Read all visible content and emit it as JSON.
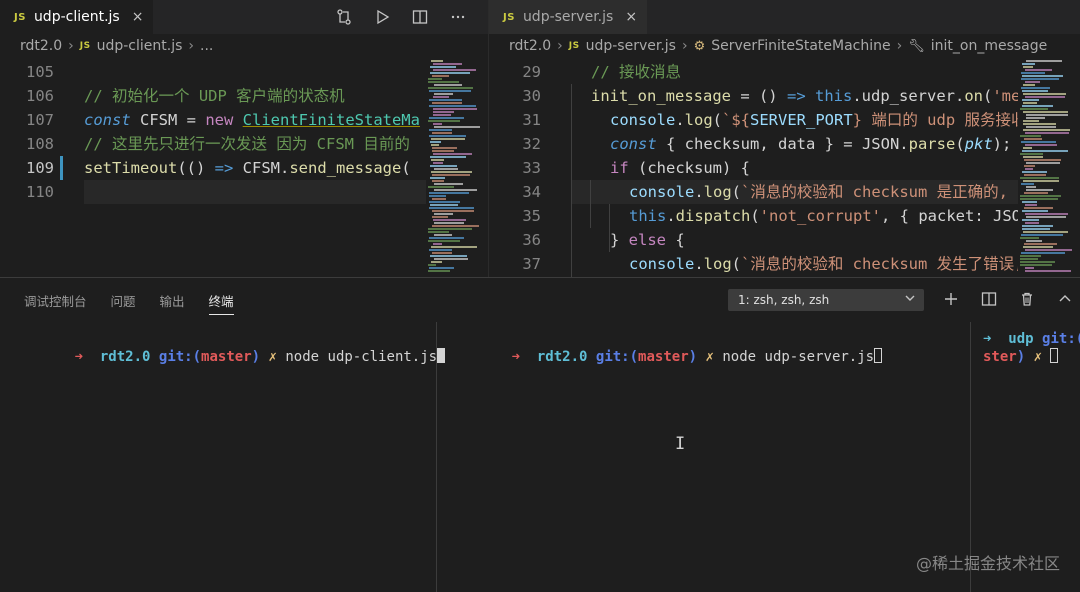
{
  "left_editor": {
    "tab": {
      "badge": "JS",
      "label": "udp-client.js",
      "close": "×"
    },
    "breadcrumb": {
      "folder": "rdt2.0",
      "badge": "JS",
      "file": "udp-client.js",
      "more": "..."
    },
    "lines": [
      {
        "n": "105",
        "segments": []
      },
      {
        "n": "106",
        "segments": [
          {
            "c": "c-comment",
            "t": "// 初始化一个 UDP 客户端的状态机"
          }
        ]
      },
      {
        "n": "107",
        "segments": [
          {
            "c": "c-kw",
            "t": "const"
          },
          {
            "c": "c-white",
            "t": " CFSM "
          },
          {
            "c": "c-white",
            "t": "= "
          },
          {
            "c": "c-new",
            "t": "new "
          },
          {
            "c": "c-cls",
            "t": "ClientFiniteStateMa"
          }
        ]
      },
      {
        "n": "108",
        "segments": [
          {
            "c": "c-comment",
            "t": "// 这里先只进行一次发送 因为 CFSM 目前的"
          }
        ]
      },
      {
        "n": "109",
        "segments": [
          {
            "c": "c-fn",
            "t": "setTimeout"
          },
          {
            "c": "c-white",
            "t": "(() "
          },
          {
            "c": "c-kw",
            "t": "=>"
          },
          {
            "c": "c-white",
            "t": " CFSM."
          },
          {
            "c": "c-fn",
            "t": "send_message"
          },
          {
            "c": "c-white",
            "t": "("
          }
        ]
      },
      {
        "n": "110",
        "segments": []
      }
    ]
  },
  "right_editor": {
    "tab": {
      "badge": "JS",
      "label": "udp-server.js",
      "close": "×"
    },
    "breadcrumb": {
      "folder": "rdt2.0",
      "badge": "JS",
      "file": "udp-server.js",
      "class": "ServerFiniteStateMachine",
      "method": "init_on_message"
    },
    "lines": [
      {
        "n": "29",
        "indent": 1,
        "segments": [
          {
            "c": "c-comment",
            "t": "// 接收消息"
          }
        ]
      },
      {
        "n": "30",
        "indent": 1,
        "segments": [
          {
            "c": "c-fn",
            "t": "init_on_message"
          },
          {
            "c": "c-white",
            "t": " = () "
          },
          {
            "c": "c-kw",
            "t": "=>"
          },
          {
            "c": "c-white",
            "t": " "
          },
          {
            "c": "c-this",
            "t": "this"
          },
          {
            "c": "c-white",
            "t": ".udp_server."
          },
          {
            "c": "c-fn",
            "t": "on"
          },
          {
            "c": "c-white",
            "t": "("
          },
          {
            "c": "c-str",
            "t": "'mess"
          }
        ]
      },
      {
        "n": "31",
        "indent": 2,
        "segments": [
          {
            "c": "c-var",
            "t": "console"
          },
          {
            "c": "c-white",
            "t": "."
          },
          {
            "c": "c-fn",
            "t": "log"
          },
          {
            "c": "c-white",
            "t": "("
          },
          {
            "c": "c-tpl",
            "t": "`${"
          },
          {
            "c": "c-tplvar",
            "t": "SERVER_PORT"
          },
          {
            "c": "c-tpl",
            "t": "} 端口的 udp 服务接收到"
          }
        ]
      },
      {
        "n": "32",
        "indent": 2,
        "segments": [
          {
            "c": "c-kw",
            "t": "const"
          },
          {
            "c": "c-white",
            "t": " { checksum, data } = JSON."
          },
          {
            "c": "c-fn",
            "t": "parse"
          },
          {
            "c": "c-white",
            "t": "("
          },
          {
            "c": "c-param",
            "t": "pkt"
          },
          {
            "c": "c-white",
            "t": ");"
          }
        ]
      },
      {
        "n": "33",
        "indent": 2,
        "segments": [
          {
            "c": "c-kw2",
            "t": "if"
          },
          {
            "c": "c-white",
            "t": " (checksum) {"
          }
        ]
      },
      {
        "n": "34",
        "indent": 3,
        "segments": [
          {
            "c": "c-var",
            "t": "console"
          },
          {
            "c": "c-white",
            "t": "."
          },
          {
            "c": "c-fn",
            "t": "log"
          },
          {
            "c": "c-white",
            "t": "("
          },
          {
            "c": "c-tpl",
            "t": "`消息的校验和 checksum 是正确的, 将这"
          }
        ]
      },
      {
        "n": "35",
        "indent": 3,
        "segments": [
          {
            "c": "c-this",
            "t": "this"
          },
          {
            "c": "c-white",
            "t": "."
          },
          {
            "c": "c-fn",
            "t": "dispatch"
          },
          {
            "c": "c-white",
            "t": "("
          },
          {
            "c": "c-str",
            "t": "'not_corrupt'"
          },
          {
            "c": "c-white",
            "t": ", { packet: JSON."
          }
        ]
      },
      {
        "n": "36",
        "indent": 2,
        "segments": [
          {
            "c": "c-white",
            "t": "} "
          },
          {
            "c": "c-kw2",
            "t": "else"
          },
          {
            "c": "c-white",
            "t": " {"
          }
        ]
      },
      {
        "n": "37",
        "indent": 3,
        "segments": [
          {
            "c": "c-var",
            "t": "console"
          },
          {
            "c": "c-white",
            "t": "."
          },
          {
            "c": "c-fn",
            "t": "log"
          },
          {
            "c": "c-white",
            "t": "("
          },
          {
            "c": "c-tpl",
            "t": "`消息的校验和 checksum 发生了错误, 将"
          }
        ]
      }
    ]
  },
  "panel": {
    "tabs": [
      "调试控制台",
      "问题",
      "输出",
      "终端"
    ],
    "active_tab": "终端",
    "terminal_select": "1: zsh, zsh, zsh",
    "terminals": [
      {
        "arrow": "➜",
        "dir": "rdt2.0",
        "git": "git:(",
        "branch": "master",
        "git_close": ")",
        "x": "✗",
        "cmd": "node udp-client.js"
      },
      {
        "arrow": "➜",
        "dir": "rdt2.0",
        "git": "git:(",
        "branch": "master",
        "git_close": ")",
        "x": "✗",
        "cmd": "node udp-server.js"
      },
      {
        "arrow": "➜",
        "dir": "udp",
        "git": "git:(",
        "branch_tail": "ster",
        "git_close": ")",
        "x": "✗"
      }
    ]
  },
  "watermark": "@稀土掘金技术社区"
}
